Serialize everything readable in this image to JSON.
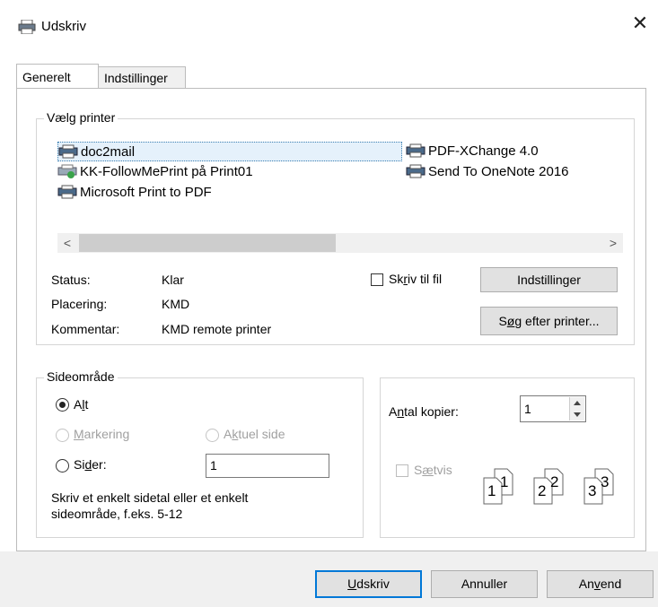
{
  "window": {
    "title": "Udskriv"
  },
  "tabs": [
    {
      "label": "Generelt"
    },
    {
      "label": "Indstillinger"
    }
  ],
  "select_printer": {
    "legend": "Vælg printer",
    "printers": [
      {
        "name": "doc2mail",
        "selected": true
      },
      {
        "name": "KK-FollowMePrint på Print01"
      },
      {
        "name": "Microsoft Print to PDF"
      },
      {
        "name": "PDF-XChange 4.0"
      },
      {
        "name": "Send To OneNote 2016"
      }
    ],
    "status_label": "Status:",
    "status_value": "Klar",
    "location_label": "Placering:",
    "location_value": "KMD",
    "comment_label": "Kommentar:",
    "comment_value": "KMD remote printer",
    "print_to_file_a": "Sk",
    "print_to_file_u": "r",
    "print_to_file_b": "iv til fil",
    "settings_button": "Indstillinger",
    "find_button_a": "S",
    "find_button_u": "ø",
    "find_button_b": "g efter printer..."
  },
  "page_range": {
    "legend": "Sideområde",
    "all_a": "A",
    "all_u": "l",
    "all_b": "t",
    "selection_u": "M",
    "selection_b": "arkering",
    "current_a": "A",
    "current_u": "k",
    "current_b": "tuel side",
    "pages_a": "Si",
    "pages_u": "d",
    "pages_b": "er:",
    "pages_value": "1",
    "hint": "Skriv et enkelt sidetal eller et enkelt sideområde, f.eks. 5-12"
  },
  "copies": {
    "label_a": "A",
    "label_u": "n",
    "label_b": "tal kopier:",
    "value": "1",
    "collate_a": "S",
    "collate_u": "æ",
    "collate_b": "tvis",
    "collate_pages": [
      "1",
      "1",
      "2",
      "2",
      "3",
      "3"
    ]
  },
  "buttons": {
    "print_u": "U",
    "print_b": "dskriv",
    "cancel": "Annuller",
    "apply_a": "An",
    "apply_u": "v",
    "apply_b": "end"
  }
}
